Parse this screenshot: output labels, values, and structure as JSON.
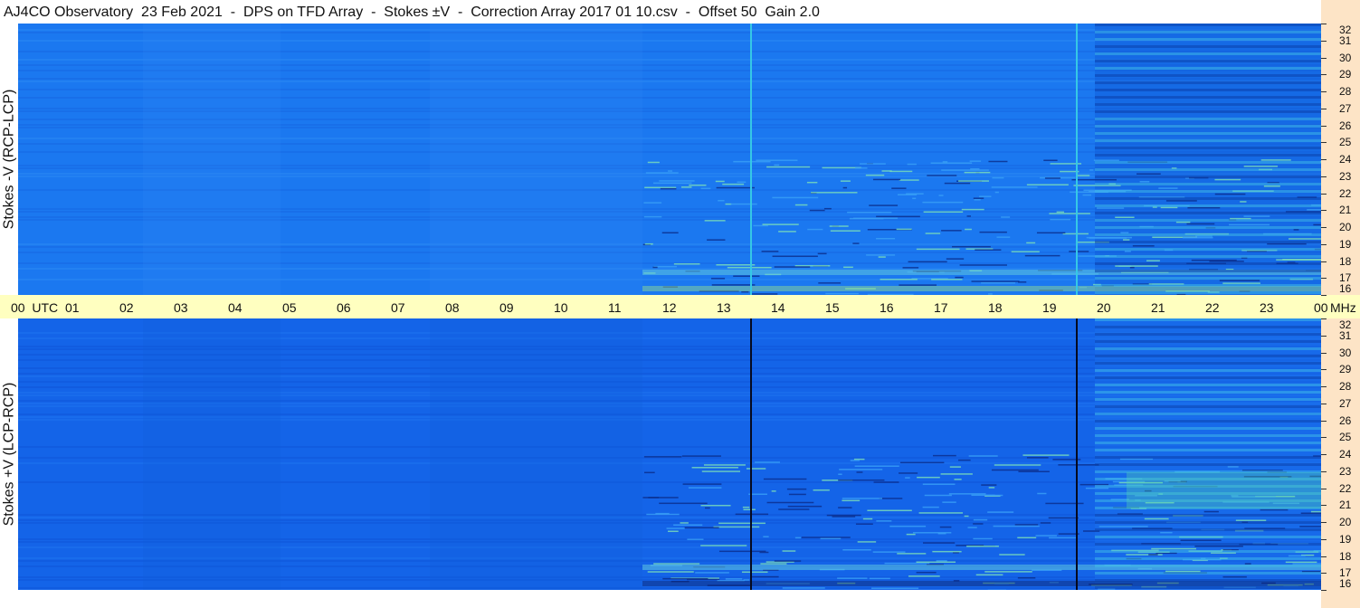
{
  "title": "AJ4CO Observatory  23 Feb 2021  -  DPS on TFD Array  -  Stokes ±V  -  Correction Array 2017 01 10.csv  -  Offset 50  Gain 2.0",
  "panels": {
    "top": {
      "label": "Stokes -V (RCP-LCP)"
    },
    "bottom": {
      "label": "Stokes +V (LCP-RCP)"
    }
  },
  "time_axis": {
    "labels": [
      "00  UTC",
      "01",
      "02",
      "03",
      "04",
      "05",
      "06",
      "07",
      "08",
      "09",
      "10",
      "11",
      "12",
      "13",
      "14",
      "15",
      "16",
      "17",
      "18",
      "19",
      "20",
      "21",
      "22",
      "23",
      "00"
    ],
    "unit": "MHz"
  },
  "freq_axis": {
    "labels": [
      "32",
      "31",
      "30",
      "29",
      "28",
      "27",
      "26",
      "25",
      "24",
      "23",
      "22",
      "21",
      "20",
      "19",
      "18",
      "17",
      "16"
    ]
  },
  "colors": {
    "background_top": "#1b78f0",
    "background_bottom": "#1464e8",
    "time_bar": "#ffffc0",
    "right_strip": "#fde4c6"
  },
  "chart_data": {
    "type": "heatmap",
    "x": {
      "unit": "UTC hour",
      "range": [
        0,
        24
      ]
    },
    "y": {
      "unit": "MHz",
      "range": [
        16,
        32
      ]
    },
    "vertical_markers_utc": [
      13.5,
      19.5
    ],
    "series": [
      {
        "name": "Stokes -V (RCP-LCP)"
      },
      {
        "name": "Stokes +V (LCP-RCP)"
      }
    ]
  }
}
